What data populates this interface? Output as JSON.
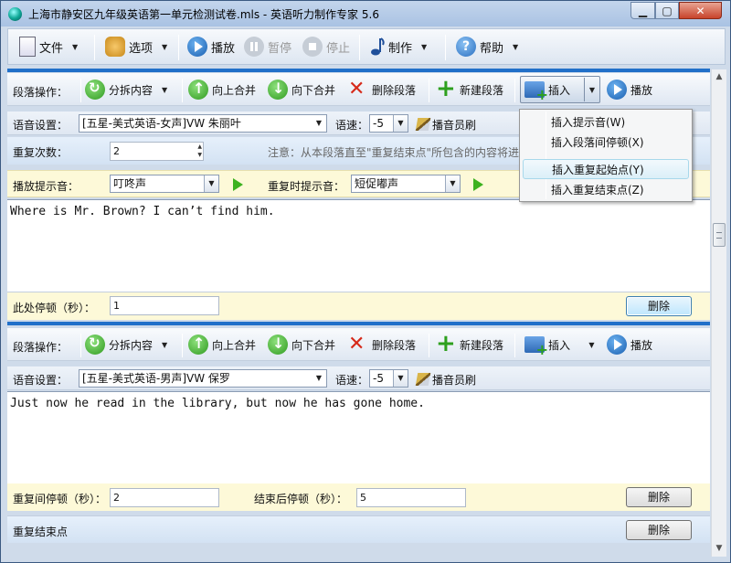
{
  "window": {
    "title": "上海市静安区九年级英语第一单元检测试卷.mls - 英语听力制作专家 5.6",
    "min": "▁",
    "max": "▢",
    "close": "✕"
  },
  "menubar": {
    "file": "文件",
    "options": "选项",
    "play": "播放",
    "pause": "暂停",
    "stop": "停止",
    "make": "制作",
    "help": "帮助",
    "dropdown": "▼"
  },
  "toolbar": {
    "para_ops_label": "段落操作：",
    "split": "分拆内容",
    "merge_up": "向上合并",
    "merge_down": "向下合并",
    "delete_para": "删除段落",
    "new_para": "新建段落",
    "insert": "插入",
    "play": "播放",
    "dropdown": "▼"
  },
  "voice": {
    "label": "语音设置：",
    "speed_label": "语速：",
    "announcer_brush": "播音员刷"
  },
  "paragraph1": {
    "voice": "[五星-美式英语-女声]VW 朱丽叶",
    "speed": "-5",
    "repeat_label": "重复次数：",
    "repeat_value": "2",
    "note": "注意：从本段落直至\"重复结束点\"所包含的内容将进行重复。",
    "hint_label": "播放提示音：",
    "hint_value": "叮咚声",
    "repeat_hint_label": "重复时提示音：",
    "repeat_hint_value": "短促嘟声",
    "text": "Where is Mr. Brown? I can’t find him.",
    "pause_label": "此处停顿（秒）：",
    "pause_value": "1",
    "delete": "删除"
  },
  "paragraph2": {
    "voice": "[五星-美式英语-男声]VW 保罗",
    "speed": "-5",
    "text": "Just now he read in the library, but now he has gone home.",
    "repeat_gap_label": "重复间停顿（秒）：",
    "repeat_gap_value": "2",
    "end_pause_label": "结束后停顿（秒）：",
    "end_pause_value": "5",
    "delete": "删除"
  },
  "repeat_end": {
    "label": "重复结束点",
    "delete": "删除"
  },
  "insert_menu": {
    "items": [
      "插入提示音(W)",
      "插入段落间停顿(X)",
      "插入重复起始点(Y)",
      "插入重复结束点(Z)"
    ],
    "highlighted": 2
  },
  "scrollbar": {
    "up": "▲",
    "down": "▼"
  }
}
